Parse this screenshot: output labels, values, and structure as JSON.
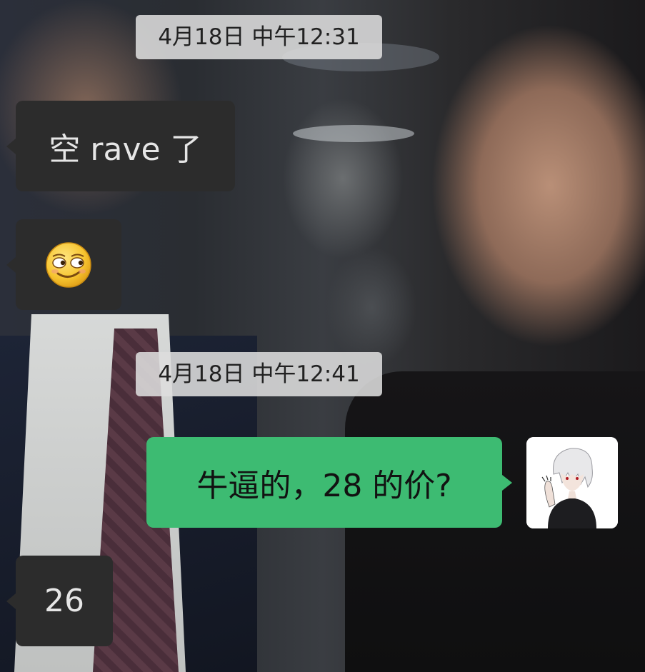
{
  "chat": {
    "timestamps": [
      "4月18日 中午12:31",
      "4月18日 中午12:41"
    ],
    "messages": [
      {
        "direction": "incoming",
        "text": "空 rave 了"
      },
      {
        "direction": "incoming",
        "emoji": "sly-smile-emoji"
      },
      {
        "direction": "outgoing",
        "text": "牛逼的，28 的价?"
      },
      {
        "direction": "incoming",
        "text": "26"
      }
    ]
  },
  "colors": {
    "incoming_bubble": "#2c2c2c",
    "outgoing_bubble": "#3dbb72",
    "timestamp_bg": "#dddddd"
  },
  "icons": {
    "self_avatar": "anime-avatar-icon"
  }
}
